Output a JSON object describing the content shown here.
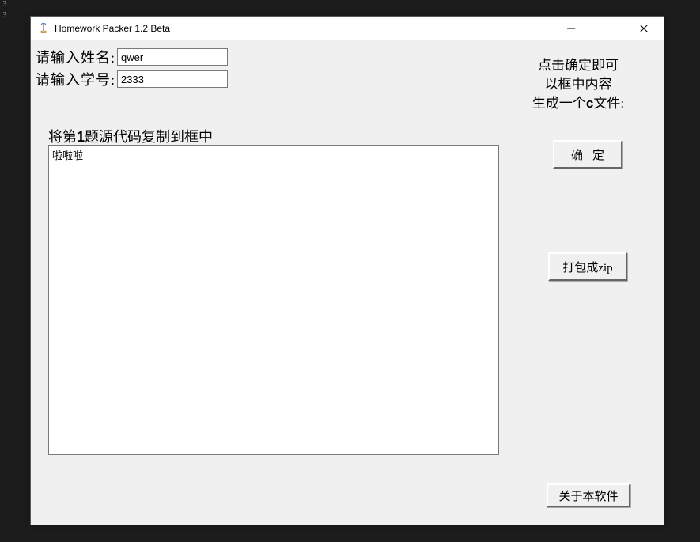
{
  "sidebar": {
    "tab1": "3",
    "tab2": "3"
  },
  "window": {
    "title": "Homework Packer 1.2 Beta"
  },
  "form": {
    "name_label": "请输入姓名:",
    "name_value": "qwer",
    "id_label": "请输入学号:",
    "id_value": "2333"
  },
  "instruction": {
    "line1": "点击确定即可",
    "line2": "以框中内容",
    "line3_prefix": "生成一个",
    "line3_bold": "c",
    "line3_suffix": "文件:"
  },
  "code_section": {
    "label_prefix": "将第",
    "label_num": "1",
    "label_suffix": "题源代码复制到框中",
    "textarea_value": "啦啦啦"
  },
  "buttons": {
    "confirm": "确定",
    "zip": "打包成zip",
    "about": "关于本软件"
  }
}
